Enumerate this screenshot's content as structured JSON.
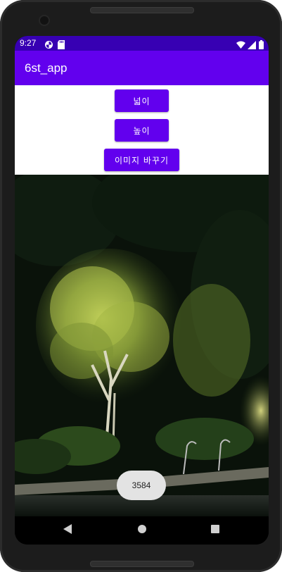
{
  "status_bar": {
    "time": "9:27",
    "left_icons": [
      "pinwheel-icon",
      "sd-card-icon"
    ],
    "right_icons": [
      "wifi-icon",
      "cellular-signal-icon",
      "battery-icon"
    ],
    "color": "#3700b3"
  },
  "app_bar": {
    "title": "6st_app",
    "color": "#6200ee"
  },
  "buttons": {
    "width_label": "넓이",
    "height_label": "높이",
    "change_image_label": "이미지 바꾸기",
    "color": "#6200ee"
  },
  "toast": {
    "text": "3584"
  },
  "nav_bar": {
    "icons": [
      "back-icon",
      "home-icon",
      "recents-icon"
    ]
  }
}
